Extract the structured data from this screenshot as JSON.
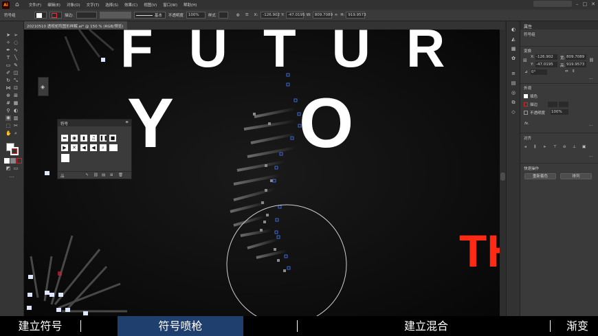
{
  "app": {
    "logo": "Ai"
  },
  "menu": [
    "文件(F)",
    "编辑(E)",
    "对象(O)",
    "文字(T)",
    "选择(S)",
    "效果(C)",
    "视图(V)",
    "窗口(W)",
    "帮助(H)"
  ],
  "control": {
    "label": "符号组",
    "stroke_label": "描边:",
    "profile": "基本",
    "opacity_label": "不透明度",
    "opacity": "100%",
    "style_label": "样式",
    "x": "-126.902",
    "y": "-47.0195",
    "w": "809.7089",
    "h": "919.9573"
  },
  "document": {
    "tab": "20210510 透视矩阵图形样解.ai* @ 150 % (RGB/预览)"
  },
  "canvas": {
    "line1": [
      "F",
      "U",
      "T",
      "U",
      "R"
    ],
    "line2": [
      "Y",
      "O"
    ],
    "red_text": "TH"
  },
  "symbols_panel": {
    "title": "符号",
    "icons": [
      "arrow-left",
      "camera",
      "film",
      "music",
      "pause",
      "stop",
      "play",
      "mute",
      "volume-down",
      "volume-up",
      "search",
      "blank"
    ],
    "footer": "品"
  },
  "properties": {
    "title": "属性",
    "type": "符号组",
    "transform_label": "变换",
    "x_label": "X:",
    "x": "-126.902",
    "y_label": "Y:",
    "y": "-47.0195",
    "w_label": "宽:",
    "w": "809.7089",
    "h_label": "高:",
    "h": "919.9573",
    "angle": "0°",
    "appearance_label": "外观",
    "fill_label": "填色",
    "stroke_label": "描边",
    "opacity_label": "不透明度",
    "opacity": "100%",
    "fx": "fx.",
    "align_label": "对齐",
    "quick_label": "快速操作",
    "recolor": "重新着色",
    "arrange": "排列"
  },
  "subtitles": [
    "建立符号",
    "符号喷枪",
    "建立混合",
    "渐变"
  ],
  "colors": {
    "red": "#ff2a14",
    "highlight": "#1f3f6e",
    "selection": "#3d6bd9"
  }
}
